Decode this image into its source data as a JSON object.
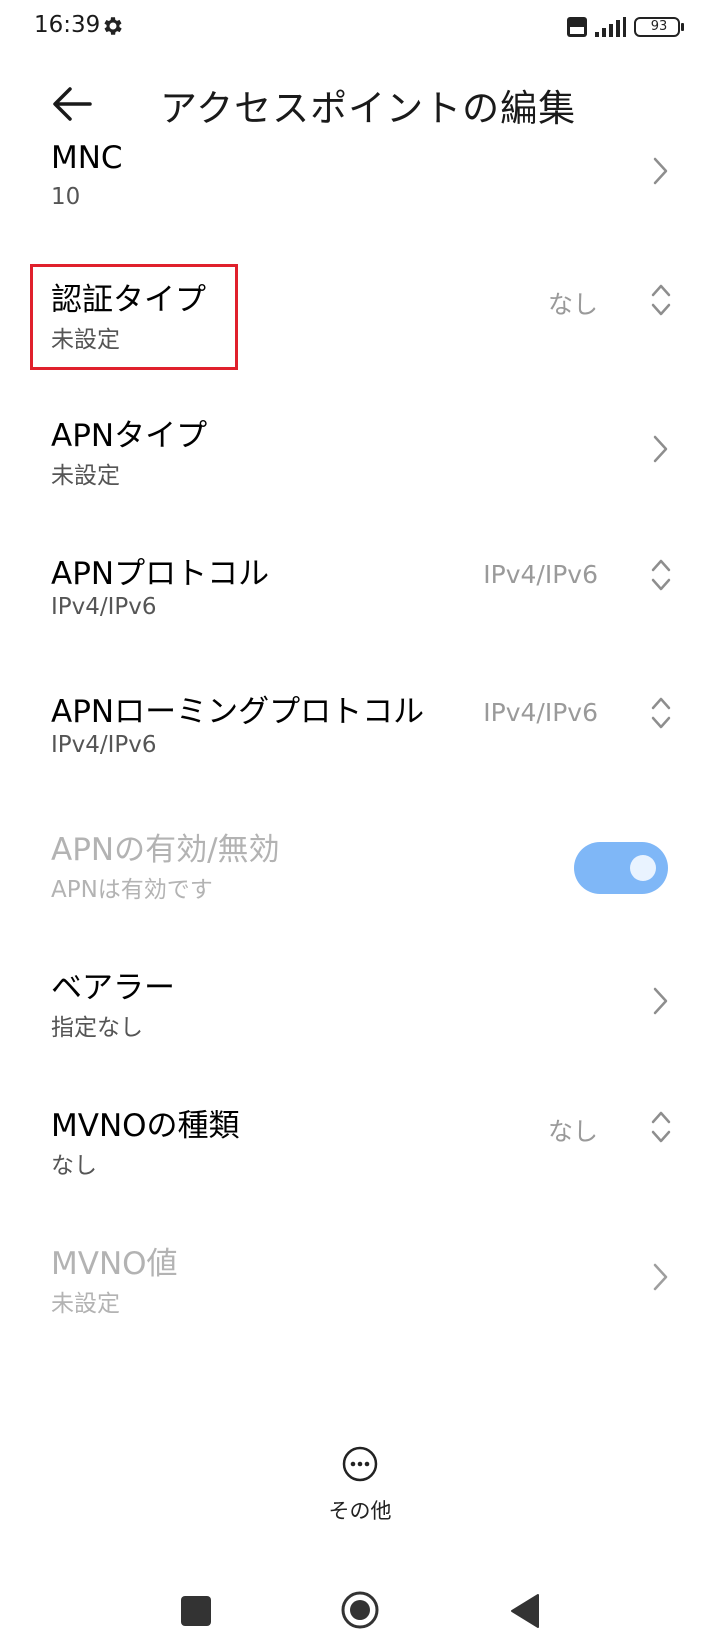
{
  "status_bar": {
    "time": "16:39",
    "battery": "93",
    "icons": [
      "gear-icon",
      "volte-icon",
      "signal-icon",
      "battery-icon"
    ]
  },
  "header": {
    "title": "アクセスポイントの編集",
    "back_icon": "arrow-left-icon"
  },
  "rows": [
    {
      "label": "MNC",
      "sub": "10",
      "value": "",
      "control": "chevron"
    },
    {
      "label": "認証タイプ",
      "sub": "未設定",
      "value": "なし",
      "control": "updown"
    },
    {
      "label": "APNタイプ",
      "sub": "未設定",
      "value": "",
      "control": "chevron"
    },
    {
      "label": "APNプロトコル",
      "sub": "IPv4/IPv6",
      "value": "IPv4/IPv6",
      "control": "updown"
    },
    {
      "label": "APNローミングプロトコル",
      "sub": "IPv4/IPv6",
      "value": "IPv4/IPv6",
      "control": "updown"
    },
    {
      "label": "APNの有効/無効",
      "sub": "APNは有効です",
      "value": "",
      "control": "toggle",
      "disabled": true,
      "toggle_on": true
    },
    {
      "label": "ベアラー",
      "sub": "指定なし",
      "value": "",
      "control": "chevron"
    },
    {
      "label": "MVNOの種類",
      "sub": "なし",
      "value": "なし",
      "control": "updown"
    },
    {
      "label": "MVNO値",
      "sub": "未設定",
      "value": "",
      "control": "chevron",
      "disabled": true
    }
  ],
  "footer": {
    "more_label": "その他"
  },
  "colors": {
    "highlight": "#e0202c",
    "toggle_on": "#7fb7f7"
  }
}
